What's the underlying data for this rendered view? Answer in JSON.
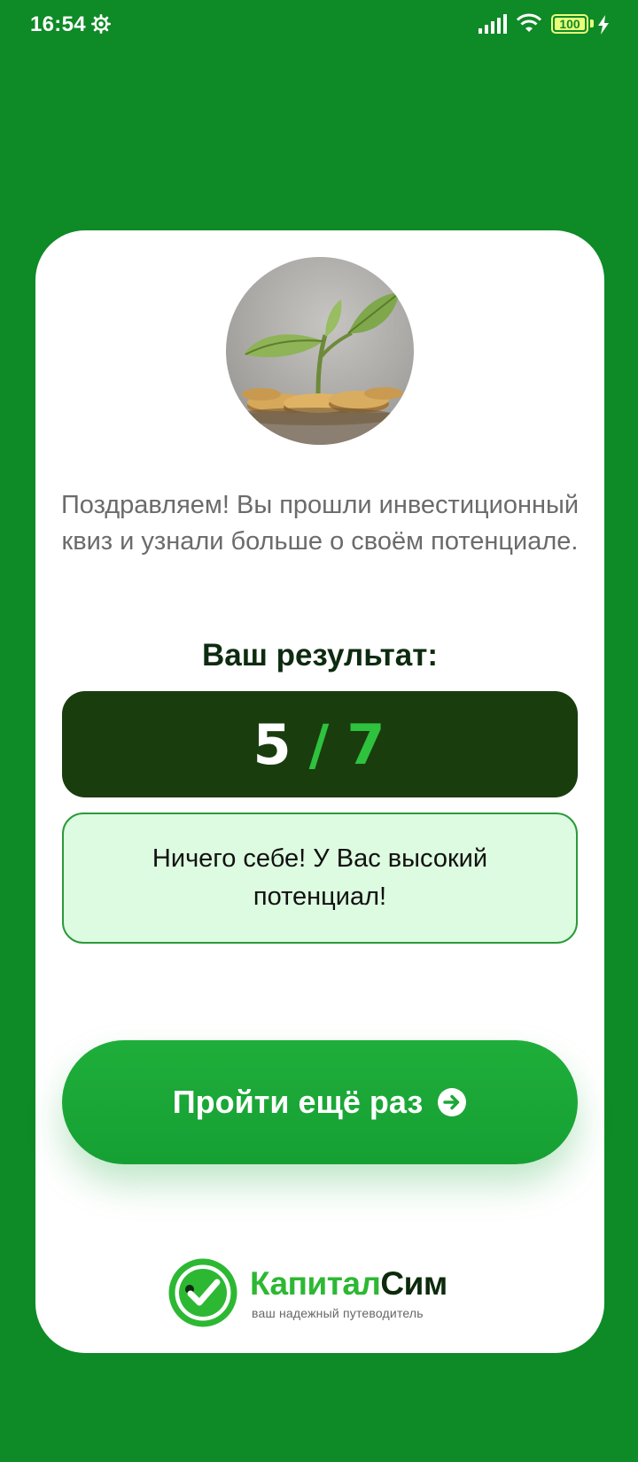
{
  "status_bar": {
    "time": "16:54",
    "battery_level": "100",
    "icons": [
      "gear-icon",
      "signal-icon",
      "wifi-icon",
      "battery-icon",
      "charging-bolt-icon"
    ]
  },
  "quiz_result": {
    "image_icon": "sprout-on-coins-image",
    "intro_text": "Поздравляем! Вы прошли инвестиционный квиз и узнали больше о своём потенциале.",
    "result_title": "Ваш результат:",
    "score": {
      "correct": "5",
      "separator": "/",
      "total": "7"
    },
    "message": "Ничего себе! У Вас высокий потенциал!",
    "retry_button_label": "Пройти ещё раз",
    "retry_button_icon": "arrow-right-circle-icon"
  },
  "brand": {
    "name_part1": "Капитал",
    "name_part2": "Сим",
    "tagline": "ваш надежный путеводитель",
    "logo_icon": "checkmark-circle-icon"
  },
  "colors": {
    "background": "#0E8A26",
    "card": "#FFFFFF",
    "score_box": "#1A3D0E",
    "accent_green": "#2EC23E",
    "message_bg": "#DDFBE0",
    "button": "#1AA736"
  }
}
